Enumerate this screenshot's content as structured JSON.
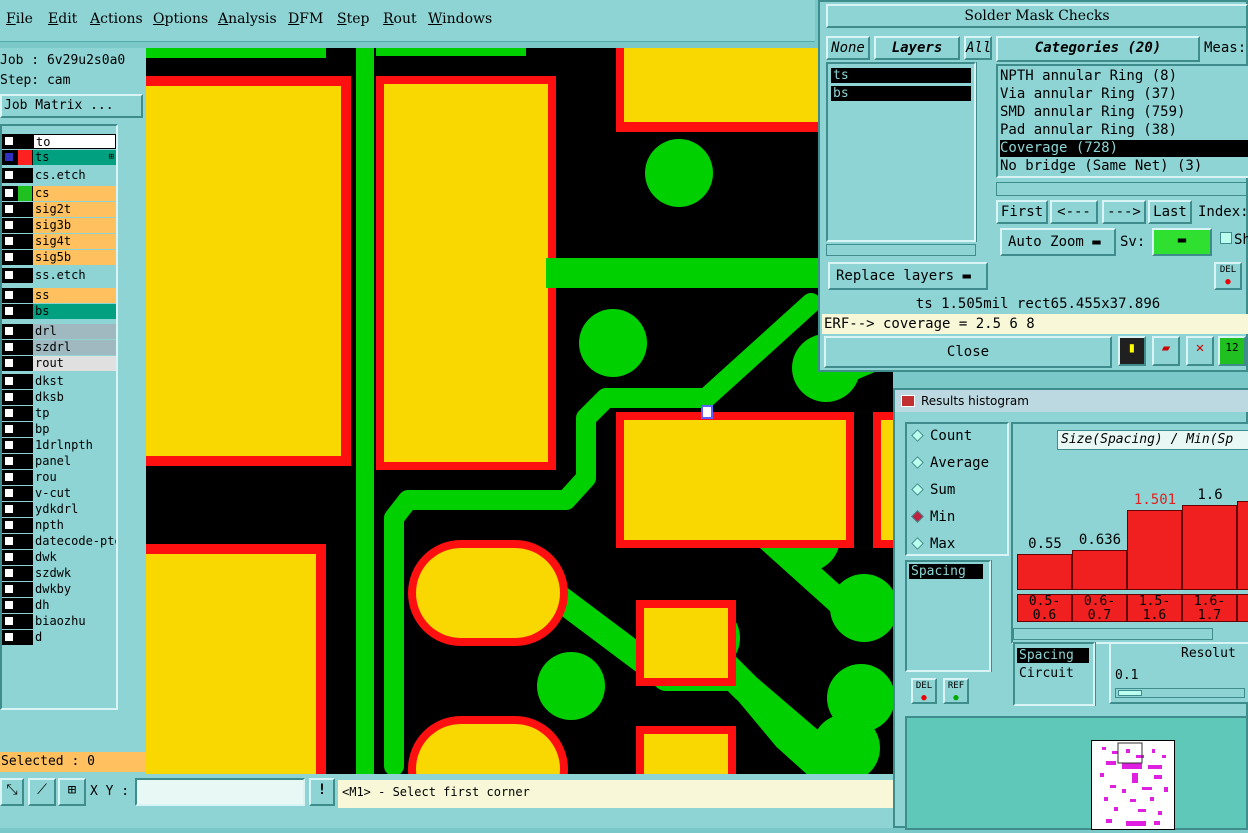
{
  "menu": [
    "File",
    "Edit",
    "Actions",
    "Options",
    "Analysis",
    "DFM",
    "Step",
    "Rout",
    "Windows"
  ],
  "left": {
    "job": "Job : 6v29u2s0a0",
    "step": "Step: cam",
    "job_matrix_button": "Job Matrix ...",
    "selected": "Selected : 0",
    "layers": [
      {
        "name": "to",
        "bg": "#ffffff",
        "color": "#000000"
      },
      {
        "name": "ts",
        "bg": "#00a080",
        "color": "#ff2020",
        "mark": "⊞"
      },
      {
        "name": "cs.etch",
        "bg": "#8ed4d4",
        "color": ""
      },
      {
        "name": "cs",
        "bg": "#ffc060",
        "color": "#20c020"
      },
      {
        "name": "sig2t",
        "bg": "#ffc060",
        "color": ""
      },
      {
        "name": "sig3b",
        "bg": "#ffc060",
        "color": ""
      },
      {
        "name": "sig4t",
        "bg": "#ffc060",
        "color": ""
      },
      {
        "name": "sig5b",
        "bg": "#ffc060",
        "color": ""
      },
      {
        "name": "ss.etch",
        "bg": "#8ed4d4",
        "color": ""
      },
      {
        "name": "ss",
        "bg": "#ffc060",
        "color": ""
      },
      {
        "name": "bs",
        "bg": "#00a080",
        "color": ""
      },
      {
        "name": "drl",
        "bg": "#a0b8c0",
        "color": ""
      },
      {
        "name": "szdrl",
        "bg": "#a0b8c0",
        "color": ""
      },
      {
        "name": "rout",
        "bg": "#e0e0e0",
        "color": ""
      },
      {
        "name": "dkst",
        "bg": "#8ed4d4",
        "color": ""
      },
      {
        "name": "dksb",
        "bg": "#8ed4d4",
        "color": ""
      },
      {
        "name": "tp",
        "bg": "#8ed4d4",
        "color": ""
      },
      {
        "name": "bp",
        "bg": "#8ed4d4",
        "color": ""
      },
      {
        "name": "1drlnpth",
        "bg": "#8ed4d4",
        "color": ""
      },
      {
        "name": "panel",
        "bg": "#8ed4d4",
        "color": ""
      },
      {
        "name": "rou",
        "bg": "#8ed4d4",
        "color": ""
      },
      {
        "name": "v-cut",
        "bg": "#8ed4d4",
        "color": ""
      },
      {
        "name": "ydkdrl",
        "bg": "#8ed4d4",
        "color": ""
      },
      {
        "name": "npth",
        "bg": "#8ed4d4",
        "color": ""
      },
      {
        "name": "datecode-pte",
        "bg": "#8ed4d4",
        "color": ""
      },
      {
        "name": "dwk",
        "bg": "#8ed4d4",
        "color": ""
      },
      {
        "name": "szdwk",
        "bg": "#8ed4d4",
        "color": ""
      },
      {
        "name": "dwkby",
        "bg": "#8ed4d4",
        "color": ""
      },
      {
        "name": "dh",
        "bg": "#8ed4d4",
        "color": ""
      },
      {
        "name": "biaozhu",
        "bg": "#8ed4d4",
        "color": ""
      },
      {
        "name": "d",
        "bg": "#8ed4d4",
        "color": ""
      }
    ]
  },
  "bottom": {
    "xy_label": "X Y :",
    "xy_value": "",
    "prompt": "<M1> - Select first corner"
  },
  "solder": {
    "title": "Solder Mask Checks",
    "none": "None",
    "layers": "Layers",
    "all": "All",
    "layer_items": [
      "ts",
      "bs"
    ],
    "categories": "Categories (20)",
    "meas": "Meas:",
    "cat_items": [
      "NPTH annular Ring (8)",
      "Via annular Ring (37)",
      "SMD annular Ring (759)",
      "Pad annular Ring (38)",
      "Coverage (728)",
      "No bridge (Same Net) (3)"
    ],
    "selected_cat": 4,
    "first": "First",
    "prev": "<---",
    "next": "--->",
    "last": "Last",
    "index": "Index:",
    "autozoom": "Auto Zoom",
    "sv": "Sv:",
    "sh": "Sh",
    "replace": "Replace layers",
    "del": "DEL",
    "status": "ts 1.505mil  rect65.455x37.896",
    "erf": "ERF--> coverage = 2.5 6 8",
    "close": "Close"
  },
  "hist": {
    "title": "Results histogram",
    "modes": [
      "Count",
      "Average",
      "Sum",
      "Min",
      "Max"
    ],
    "selected_mode": 3,
    "list_item": "Spacing",
    "del": "DEL",
    "ref": "REF",
    "header": "Size(Spacing) / Min(Sp",
    "bars": [
      {
        "label_top": "0.5-",
        "label_bot": "0.6",
        "value": 0.55,
        "display": "0.55",
        "red": false
      },
      {
        "label_top": "0.6-",
        "label_bot": "0.7",
        "value": 0.636,
        "display": "0.636",
        "red": false
      },
      {
        "label_top": "1.5-",
        "label_bot": "1.6",
        "value": 1.501,
        "display": "1.501",
        "red": true
      },
      {
        "label_top": "1.6-",
        "label_bot": "1.7",
        "value": 1.6,
        "display": "1.6",
        "red": false
      },
      {
        "label_top": "",
        "label_bot": "",
        "value": 1.7,
        "display": "",
        "red": false
      }
    ],
    "bottom_items": [
      "Spacing",
      "Circuit"
    ],
    "resolution": "Resolut",
    "res_value": "0.1"
  },
  "colors": {
    "copper": "#00d000",
    "pad": "#f8d800",
    "mask": "#ff1010",
    "ui": "#8ed4d4"
  }
}
